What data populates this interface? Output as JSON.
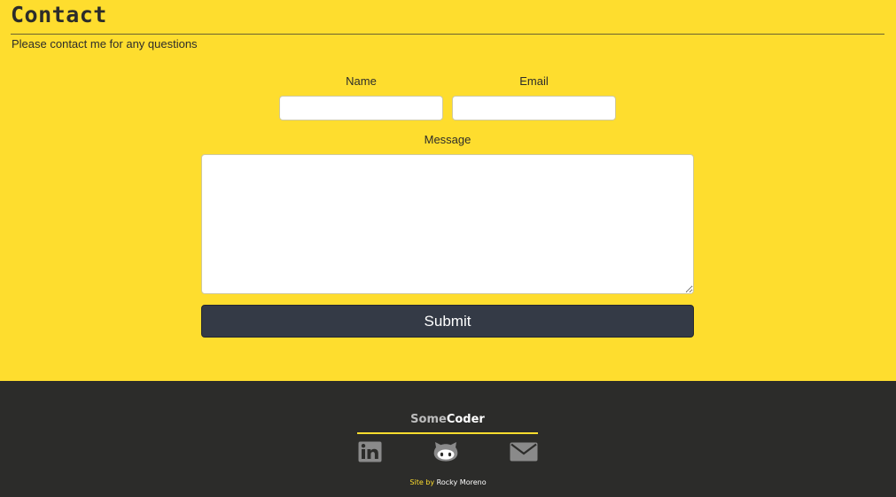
{
  "header": {
    "title": "Contact",
    "subtitle": "Please contact me for any questions"
  },
  "form": {
    "name_label": "Name",
    "name_value": "",
    "email_label": "Email",
    "email_value": "",
    "message_label": "Message",
    "message_value": "",
    "submit_label": "Submit"
  },
  "footer": {
    "brand_part1": "Some",
    "brand_part2": "Coder",
    "social": [
      {
        "icon": "linkedin-icon"
      },
      {
        "icon": "github-icon"
      },
      {
        "icon": "email-icon"
      }
    ],
    "credit_prefix": "Site by",
    "credit_name": "Rocky Moreno"
  },
  "colors": {
    "accent_yellow": "#fedd2e",
    "footer_dark": "#2c2c2a",
    "button_dark": "#343a46",
    "icon_gray": "#8a8a8a"
  }
}
